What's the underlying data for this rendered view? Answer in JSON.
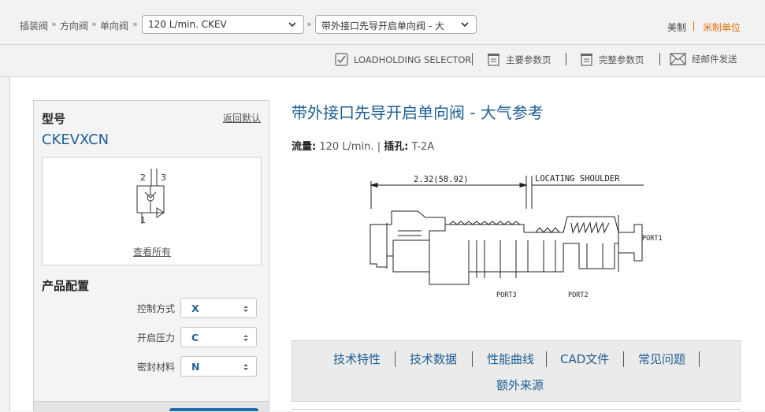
{
  "breadcrumb": {
    "items": [
      "插装阀",
      "方向阀",
      "单向阀"
    ],
    "separator": "»",
    "flow_select": "120 L/min. CKEV",
    "product_select": "带外接口先导开启单向阀 - 大"
  },
  "units": {
    "us": "美制",
    "metric": "米制单位",
    "metric_color": "#e36c09"
  },
  "toolbar": {
    "selector": "LOADHOLDING SELECTOR",
    "main_params": "主要参数页",
    "full_params": "完整参数页",
    "email": "经邮件发送"
  },
  "config_panel": {
    "model_label": "型号",
    "reset_link": "返回默认",
    "model_code": "CKEVXCN",
    "symbol_ports": [
      "2",
      "3",
      "1"
    ],
    "view_all": "查看所有",
    "config_title": "产品配置",
    "options": [
      {
        "label": "控制方式",
        "value": "X"
      },
      {
        "label": "开启压力",
        "value": "C"
      },
      {
        "label": "密封材料",
        "value": "N"
      }
    ]
  },
  "product": {
    "title": "带外接口先导开启单向阀 - 大气参考",
    "flow_label": "流量:",
    "flow_value": "120 L/min.",
    "meta_sep": "|",
    "cavity_label": "插孔:",
    "cavity_value": "T-2A"
  },
  "drawing": {
    "dimension": "2.32(58.92)",
    "shoulder_label": "LOCATING SHOULDER",
    "port1": "PORT1",
    "port2": "PORT2",
    "port3": "PORT3"
  },
  "tabs": [
    "技术特性",
    "技术数据",
    "性能曲线",
    "CAD文件",
    "常见问题",
    "额外来源"
  ],
  "colors": {
    "accent": "#1f5f95",
    "link_orange": "#e36c09"
  }
}
